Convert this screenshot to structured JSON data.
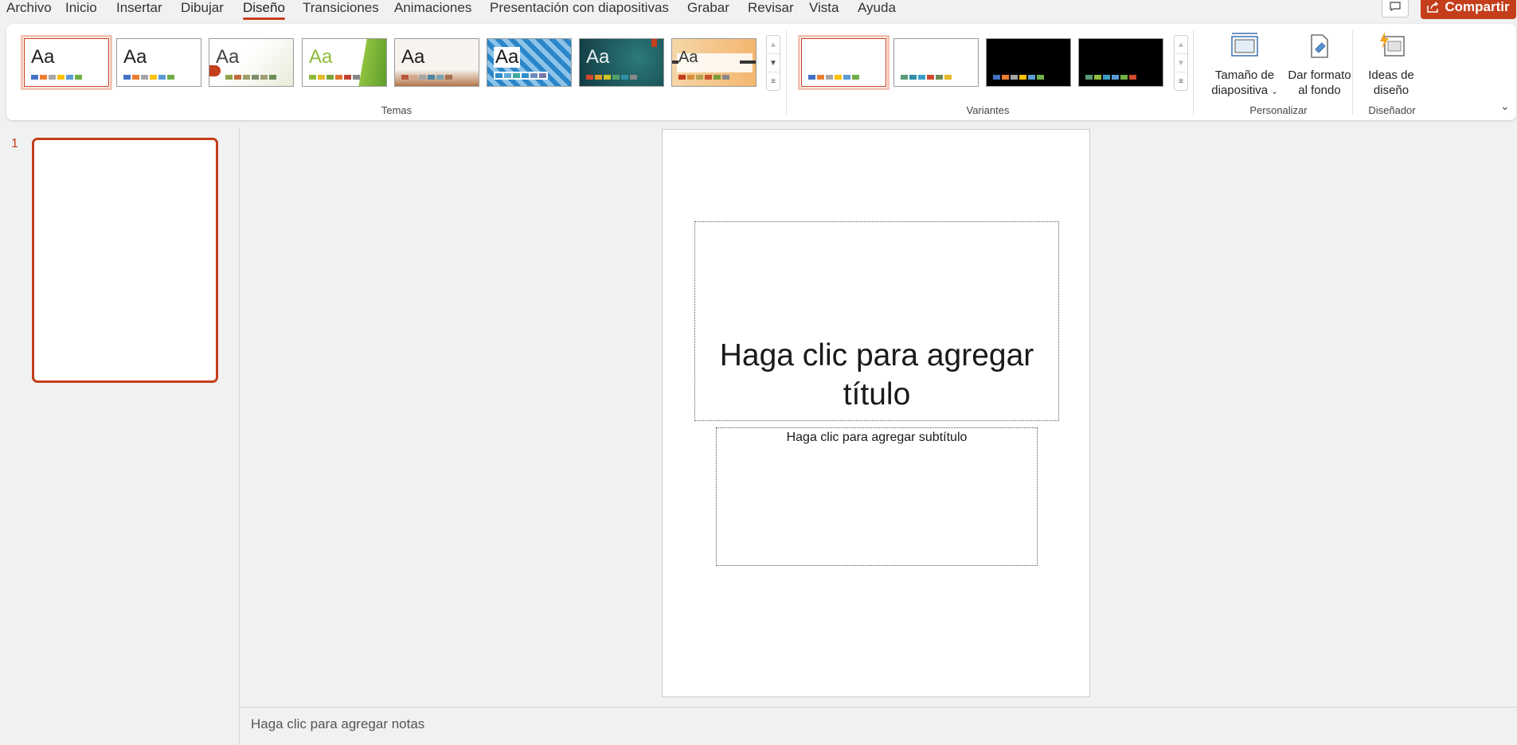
{
  "menu": {
    "items": [
      "Archivo",
      "Inicio",
      "Insertar",
      "Dibujar",
      "Diseño",
      "Transiciones",
      "Animaciones",
      "Presentación con diapositivas",
      "Grabar",
      "Revisar",
      "Vista",
      "Ayuda"
    ],
    "active": "Diseño",
    "share_label": "Compartir"
  },
  "ribbon": {
    "themes_label": "Temas",
    "variants_label": "Variantes",
    "customize_label": "Personalizar",
    "designer_label": "Diseñador",
    "theme_sample_text": "Aa",
    "slide_size": {
      "line1": "Tamaño de",
      "line2": "diapositiva"
    },
    "format_background": {
      "line1": "Dar formato",
      "line2": "al fondo"
    },
    "design_ideas": {
      "line1": "Ideas de",
      "line2": "diseño"
    }
  },
  "slides": {
    "current_number": "1"
  },
  "slide": {
    "title_placeholder": "Haga clic para agregar título",
    "subtitle_placeholder": "Haga clic para agregar subtítulo"
  },
  "notes": {
    "placeholder": "Haga clic para agregar notas"
  },
  "colors": {
    "accent": "#c43e1c"
  }
}
